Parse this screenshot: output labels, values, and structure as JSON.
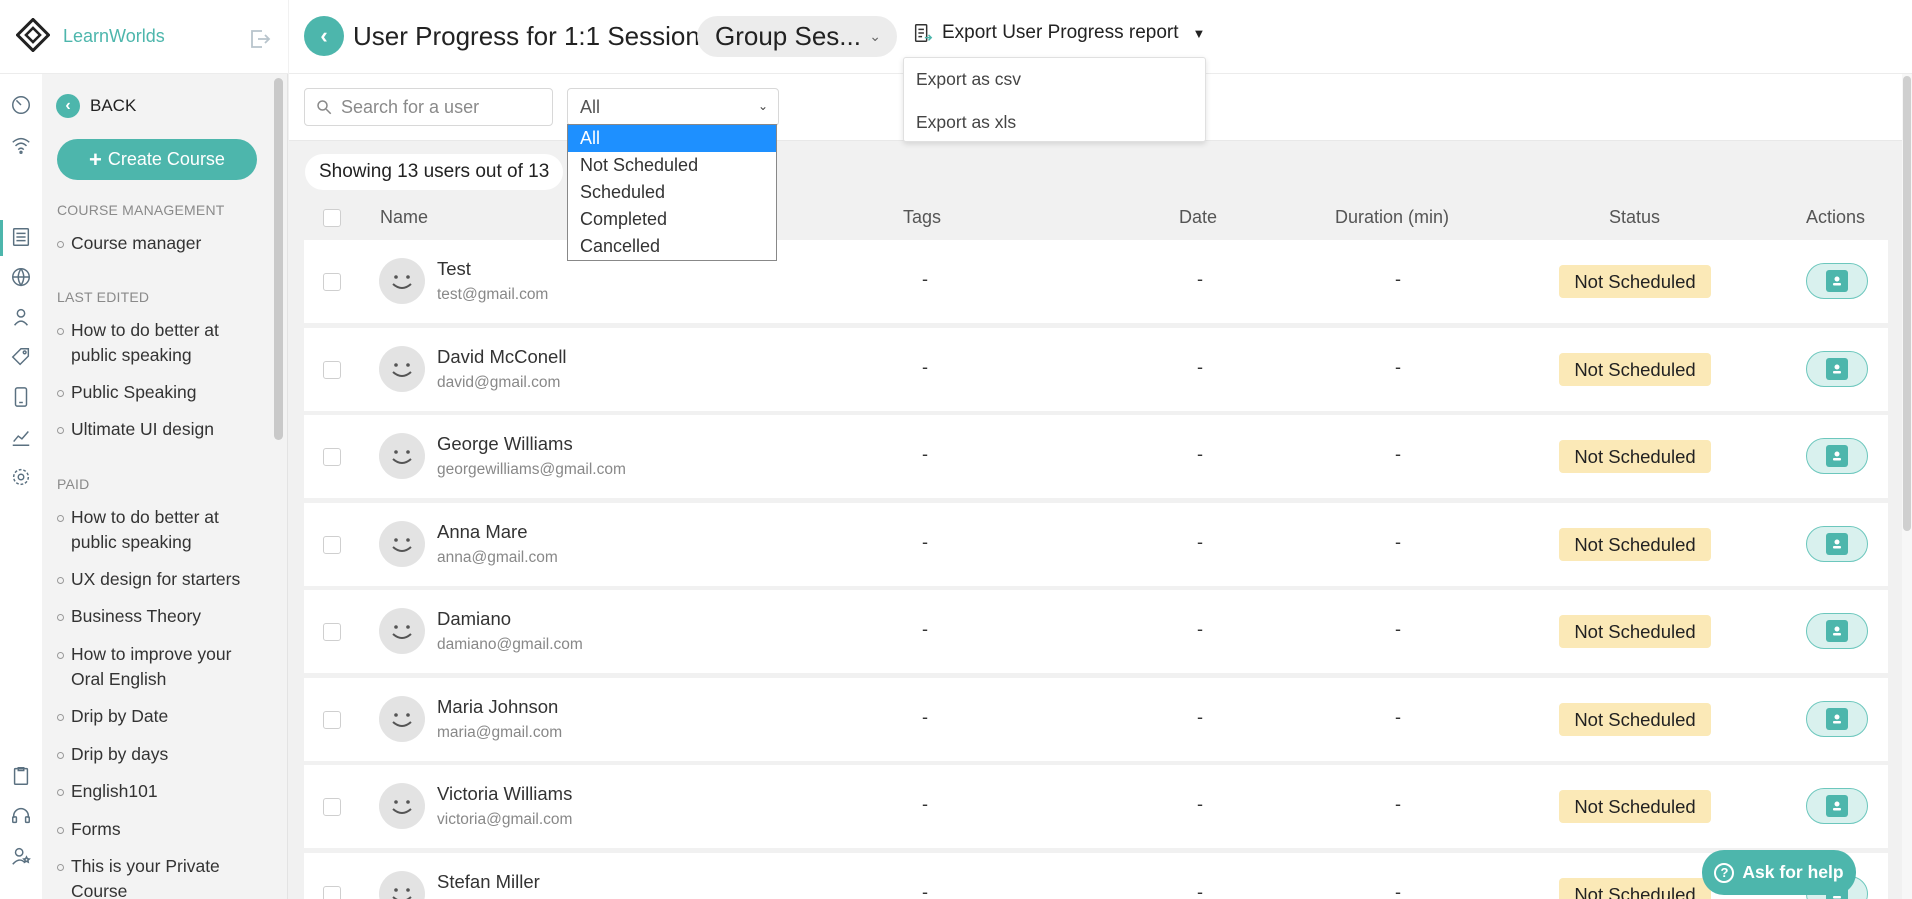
{
  "brand": {
    "name": "LearnWorlds"
  },
  "sidebar": {
    "back_label": "BACK",
    "create_label": "Create Course",
    "sections": [
      {
        "title": "COURSE MANAGEMENT",
        "items": [
          "Course manager"
        ]
      },
      {
        "title": "LAST EDITED",
        "items": [
          "How to do better at public speaking",
          "Public Speaking",
          "Ultimate UI design"
        ]
      },
      {
        "title": "PAID",
        "items": [
          "How to do better at public speaking",
          "UX design for starters",
          "Business Theory",
          "How to improve your Oral English",
          "Drip by Date",
          "Drip by days",
          "English101",
          "Forms",
          "This is your Private Course"
        ]
      }
    ]
  },
  "header": {
    "title": "User Progress for 1:1 Session",
    "group_select": "Group Ses...",
    "export_label": "Export User Progress report",
    "export_menu": [
      "Export as csv",
      "Export as xls"
    ]
  },
  "filters": {
    "search_placeholder": "Search for a user",
    "status_value": "All",
    "status_options": [
      "All",
      "Not Scheduled",
      "Scheduled",
      "Completed",
      "Cancelled"
    ]
  },
  "summary": "Showing 13 users out of 13",
  "table": {
    "columns": [
      "Name",
      "Tags",
      "Date",
      "Duration (min)",
      "Status",
      "Actions"
    ],
    "rows": [
      {
        "name": "Test",
        "email": "test@gmail.com",
        "tags": "-",
        "date": "-",
        "duration": "-",
        "status": "Not Scheduled"
      },
      {
        "name": "David McConell",
        "email": "david@gmail.com",
        "tags": "-",
        "date": "-",
        "duration": "-",
        "status": "Not Scheduled"
      },
      {
        "name": "George Williams",
        "email": "georgewilliams@gmail.com",
        "tags": "-",
        "date": "-",
        "duration": "-",
        "status": "Not Scheduled"
      },
      {
        "name": "Anna Mare",
        "email": "anna@gmail.com",
        "tags": "-",
        "date": "-",
        "duration": "-",
        "status": "Not Scheduled"
      },
      {
        "name": "Damiano",
        "email": "damiano@gmail.com",
        "tags": "-",
        "date": "-",
        "duration": "-",
        "status": "Not Scheduled"
      },
      {
        "name": "Maria Johnson",
        "email": "maria@gmail.com",
        "tags": "-",
        "date": "-",
        "duration": "-",
        "status": "Not Scheduled"
      },
      {
        "name": "Victoria Williams",
        "email": "victoria@gmail.com",
        "tags": "-",
        "date": "-",
        "duration": "-",
        "status": "Not Scheduled"
      },
      {
        "name": "Stefan Miller",
        "email": "",
        "tags": "-",
        "date": "-",
        "duration": "-",
        "status": "Not Scheduled"
      }
    ]
  },
  "help_label": "Ask for help",
  "colors": {
    "accent": "#4db6ac",
    "badge": "#fbe9b7",
    "selected_option": "#1e90ff"
  },
  "icons": [
    "logo-icon",
    "logout-icon",
    "speedometer-icon",
    "wifi-icon",
    "courses-icon",
    "globe-icon",
    "users-icon",
    "tag-icon",
    "mobile-icon",
    "chart-icon",
    "gear-icon",
    "clipboard-icon",
    "headset-icon",
    "star-user-icon",
    "search-icon",
    "export-icon",
    "profile-card-icon"
  ]
}
